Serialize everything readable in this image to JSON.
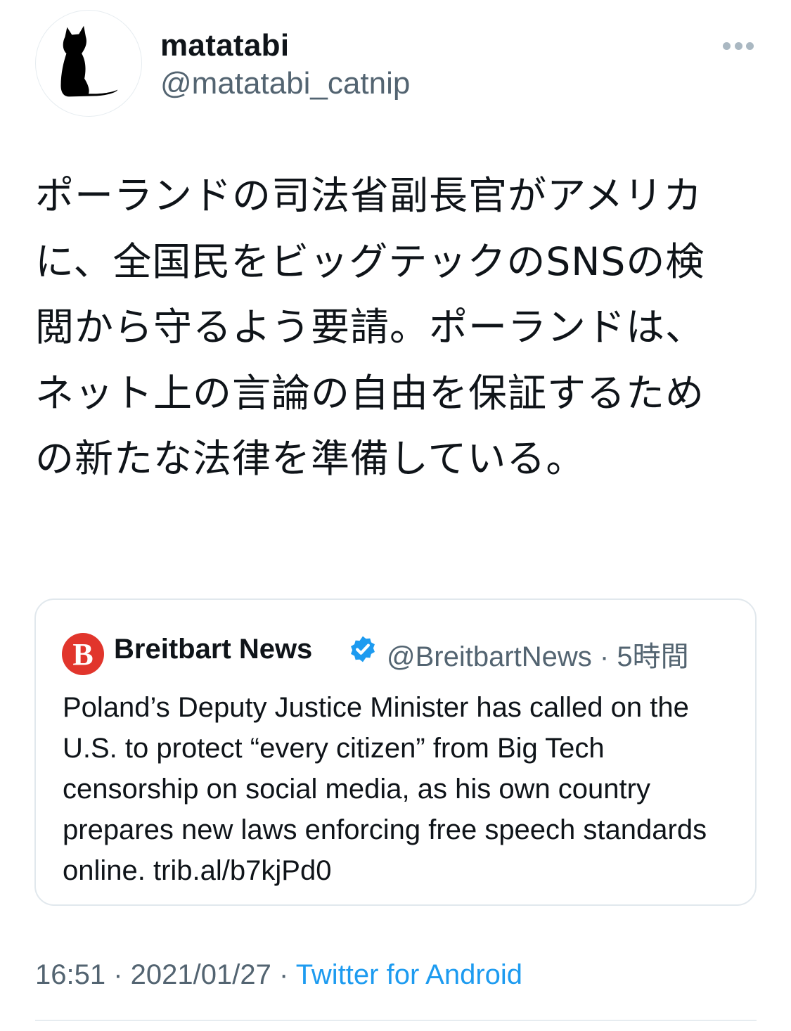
{
  "author": {
    "display_name": "matatabi",
    "handle": "@matatabi_catnip",
    "avatar_icon": "cat-silhouette-icon"
  },
  "menu_icon": "more-horizontal-icon",
  "tweet": {
    "text": "ポーランドの司法省副長官がアメリカに、全国民をビッグテックのSNSの検閲から守るよう要請。ポーランドは、ネット上の言論の自由を保証するための新たな法律を準備している。"
  },
  "quoted": {
    "logo_letter": "B",
    "display_name": "Breitbart News",
    "verified": true,
    "handle": "@BreitbartNews",
    "separator": " · ",
    "time": "5時間",
    "text": "Poland’s Deputy Justice Minister has called on the U.S. to protect “every citizen” from Big Tech censorship on social media, as his own country prepares new laws enforcing free speech standards online. trib.al/b7kjPd0",
    "colors": {
      "logo_bg": "#e1352c",
      "verified": "#1d9bf0"
    }
  },
  "meta": {
    "time": "16:51",
    "date": "2021/01/27",
    "separator": " · ",
    "source": "Twitter for Android"
  },
  "colors": {
    "link": "#1d9bf0",
    "secondary": "#536471",
    "border": "#e1e8ed"
  }
}
